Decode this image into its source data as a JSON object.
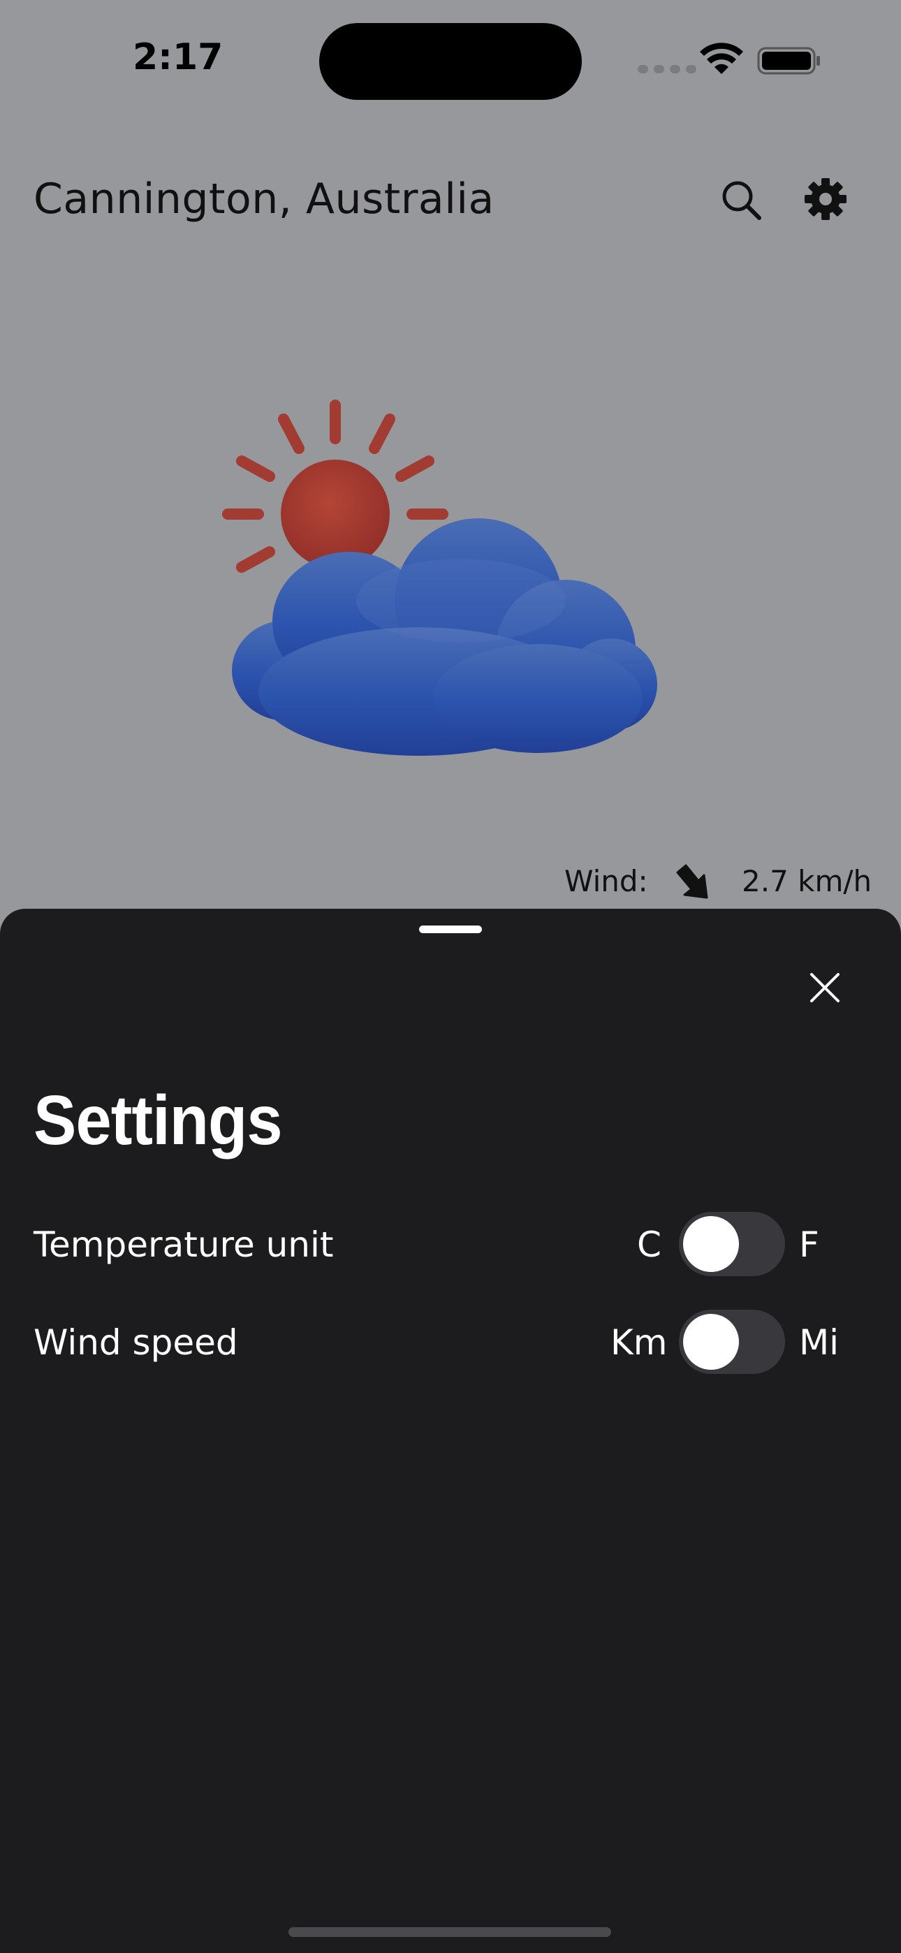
{
  "status_bar": {
    "time": "2:17"
  },
  "header": {
    "location": "Cannington, Australia",
    "search_icon": "search-icon",
    "settings_icon": "gear-icon"
  },
  "weather": {
    "condition_icon": "partly-cloudy-icon",
    "wind_label": "Wind:",
    "wind_value": "2.7 km/h"
  },
  "settings_sheet": {
    "title": "Settings",
    "rows": [
      {
        "label": "Temperature unit",
        "left_option": "C",
        "right_option": "F",
        "toggle_on": false
      },
      {
        "label": "Wind speed",
        "left_option": "Km",
        "right_option": "Mi",
        "toggle_on": false
      }
    ]
  },
  "colors": {
    "background_dimmed": "#96989c",
    "sheet": "#1c1c1e",
    "toggle_track": "#39393d",
    "sun": "#a8362a",
    "cloud": "#2a4fa6"
  }
}
